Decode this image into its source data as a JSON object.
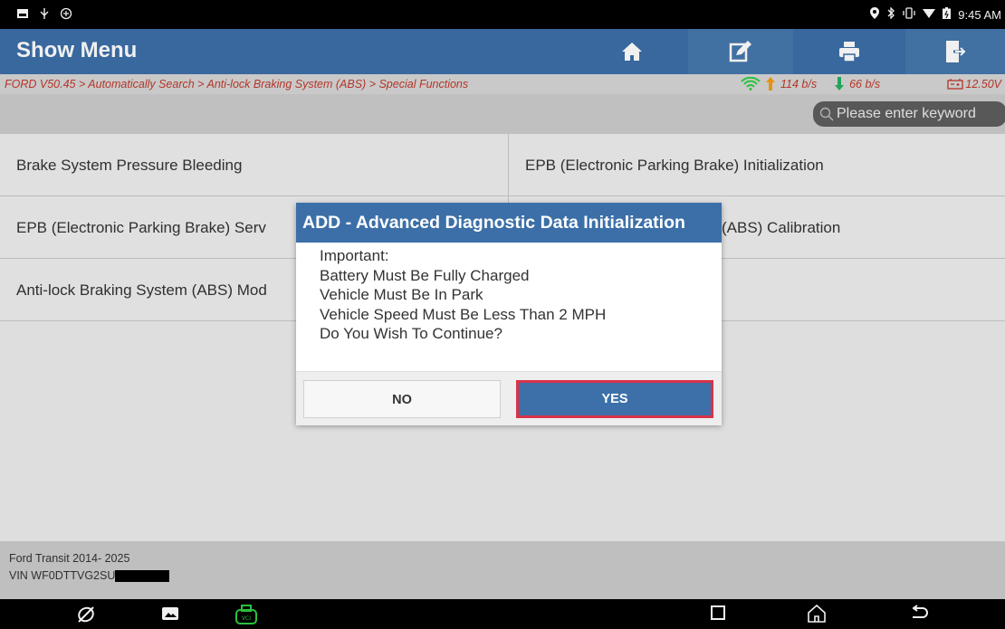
{
  "status_bar": {
    "time": "9:45 AM",
    "right_icons": [
      "location-icon",
      "bluetooth-icon",
      "vibrate-icon",
      "wifi-icon",
      "battery-icon"
    ],
    "left_icons": [
      "screenshot-icon",
      "usb-icon",
      "debug-icon"
    ]
  },
  "header": {
    "title": "Show Menu",
    "buttons": [
      "home-icon",
      "edit-icon",
      "print-icon",
      "exit-icon"
    ]
  },
  "breadcrumb": {
    "text": "FORD V50.45 > Automatically Search > Anti-lock Braking System (ABS) > Special Functions"
  },
  "network": {
    "up": "114 b/s",
    "down": "66 b/s",
    "voltage": "12.50V"
  },
  "search": {
    "placeholder": "Please enter keyword"
  },
  "menu": {
    "items": [
      "Brake System Pressure Bleeding",
      "EPB (Electronic Parking Brake) Initialization",
      "EPB (Electronic Parking Brake) Serv",
      "(ABS) Calibration",
      "Anti-lock Braking System (ABS) Mod"
    ]
  },
  "footer": {
    "model": "Ford Transit 2014- 2025",
    "vin_prefix": "VIN WF0DTTVG2SU"
  },
  "dialog": {
    "title": "ADD - Advanced Diagnostic Data Initialization",
    "lines": [
      "Important:",
      "Battery Must Be Fully Charged",
      "Vehicle Must Be In Park",
      "Vehicle Speed Must Be Less Than 2 MPH",
      "Do You Wish To Continue?"
    ],
    "no_label": "NO",
    "yes_label": "YES"
  },
  "colors": {
    "accent": "#3c6fa7",
    "breadcrumb": "#c0392b",
    "highlight_border": "#d8324a",
    "up_arrow": "#f39c12",
    "down_arrow": "#27ae60",
    "vci": "#2ecc40"
  }
}
